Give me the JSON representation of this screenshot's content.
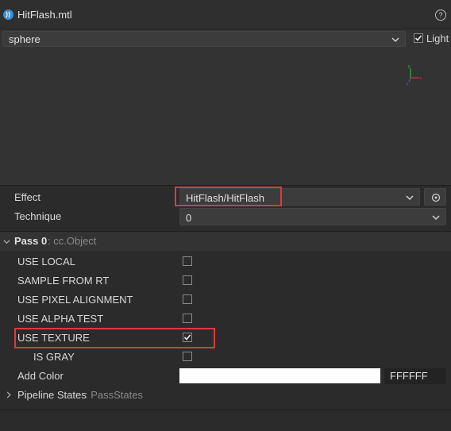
{
  "header": {
    "title": "HitFlash.mtl",
    "help_label": "?"
  },
  "preview": {
    "mesh_value": "sphere",
    "light_label": "Light",
    "light_checked": true,
    "axes": {
      "x": "x",
      "y": "y",
      "z": "z"
    }
  },
  "material": {
    "effect_label": "Effect",
    "effect_value": "HitFlash/HitFlash",
    "technique_label": "Technique",
    "technique_value": "0"
  },
  "pass": {
    "title": "Pass 0",
    "type": ": cc.Object",
    "props": [
      {
        "label": "USE LOCAL",
        "checked": false
      },
      {
        "label": "SAMPLE FROM RT",
        "checked": false
      },
      {
        "label": "USE PIXEL ALIGNMENT",
        "checked": false
      },
      {
        "label": "USE ALPHA TEST",
        "checked": false
      },
      {
        "label": "USE TEXTURE",
        "checked": true
      },
      {
        "label": "IS GRAY",
        "checked": false
      }
    ],
    "add_color_label": "Add Color",
    "add_color_hex": "FFFFFF",
    "add_color_value": "#ffffff",
    "pipeline_label": "Pipeline States",
    "pipeline_type": ": PassStates"
  },
  "colors": {
    "highlight": "#e0393e",
    "accent": "#3b8ed8"
  }
}
